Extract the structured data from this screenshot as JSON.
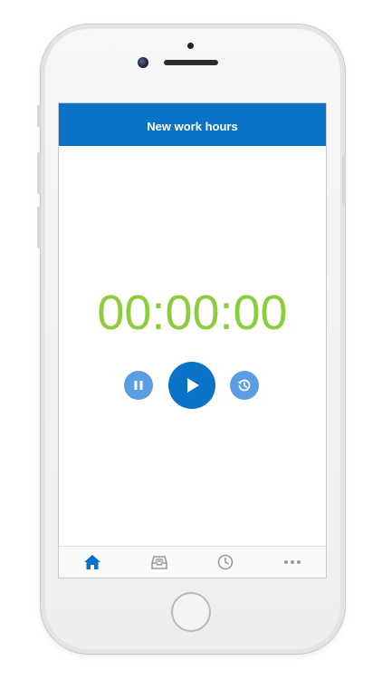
{
  "app": {
    "title": "New work hours"
  },
  "timer": {
    "display": "00:00:00",
    "color": "#8fcc3d"
  },
  "controls": {
    "pause_icon": "pause-icon",
    "play_icon": "play-icon",
    "history_icon": "history-icon"
  },
  "tabbar": {
    "items": [
      {
        "icon": "home-icon",
        "active": true
      },
      {
        "icon": "inbox-tray-icon",
        "active": false
      },
      {
        "icon": "clock-icon",
        "active": false
      },
      {
        "icon": "more-icon",
        "active": false
      }
    ]
  },
  "colors": {
    "primary": "#0a73c8",
    "secondary": "#5a9de3",
    "inactive_icon": "#9a9a9a"
  }
}
